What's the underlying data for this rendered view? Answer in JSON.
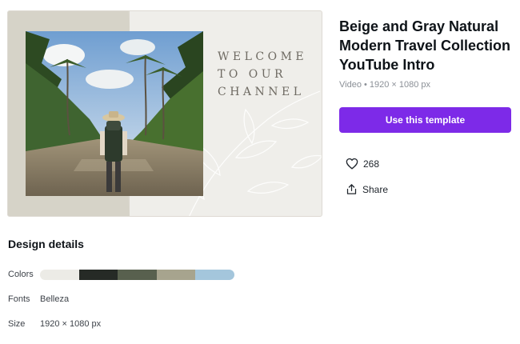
{
  "preview": {
    "welcome_text": "WELCOME\nTO OUR\nCHANNEL"
  },
  "template": {
    "title": "Beige and Gray Natural Modern Travel Collection YouTube Intro",
    "meta": "Video • 1920 × 1080 px",
    "cta_label": "Use this template"
  },
  "actions": {
    "likes_count": "268",
    "share_label": "Share",
    "like_icon": "heart-icon",
    "share_icon": "share-icon"
  },
  "design_details": {
    "heading": "Design details",
    "colors_label": "Colors",
    "colors": [
      "#ecebe6",
      "#262a26",
      "#58604e",
      "#a7a48e",
      "#a4c6dc"
    ],
    "fonts_label": "Fonts",
    "fonts_value": "Belleza",
    "size_label": "Size",
    "size_value": "1920 × 1080 px"
  },
  "accent_color": "#7d2ae8"
}
